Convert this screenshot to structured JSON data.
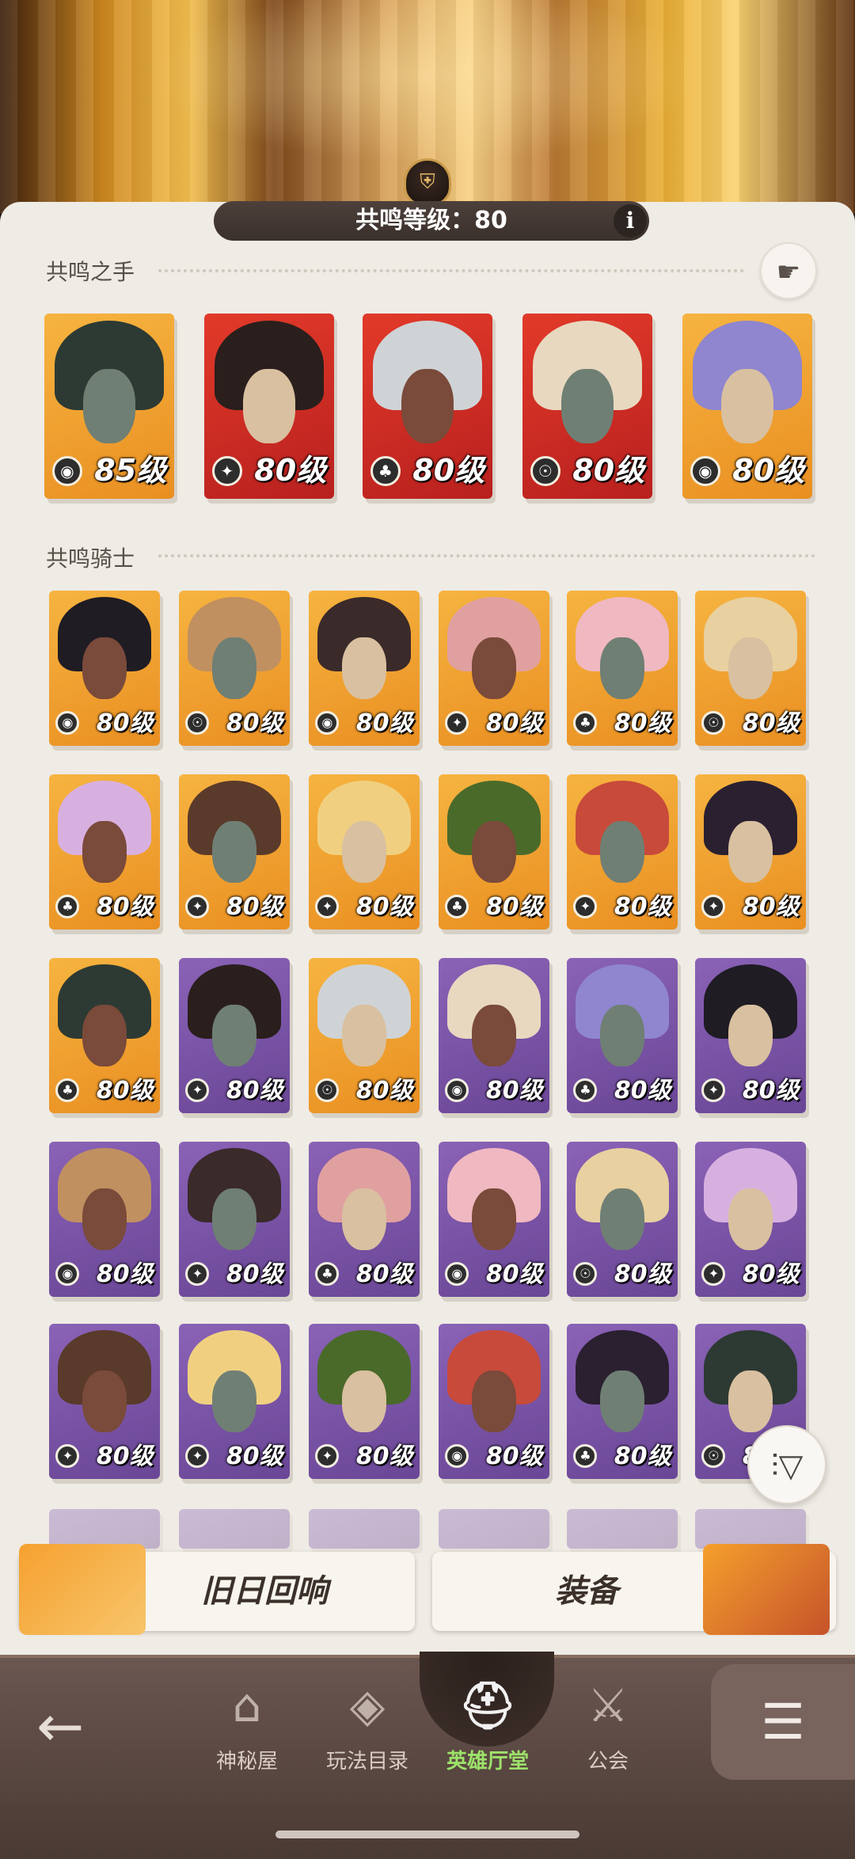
{
  "header": {
    "resonance_label": "共鸣等级：80",
    "info_label": "i",
    "crest_icon": "helmet-crest-icon"
  },
  "hand_section": {
    "title": "共鸣之手",
    "heroes": [
      {
        "level": "85级",
        "bg": "gold",
        "faction": "dark"
      },
      {
        "level": "80级",
        "bg": "red",
        "faction": "blue"
      },
      {
        "level": "80级",
        "bg": "red",
        "faction": "green"
      },
      {
        "level": "80级",
        "bg": "red",
        "faction": "gold"
      },
      {
        "level": "80级",
        "bg": "gold",
        "faction": "dark"
      }
    ]
  },
  "knight_section": {
    "title": "共鸣骑士",
    "rows": [
      [
        {
          "level": "80级",
          "bg": "gold",
          "faction": "dark"
        },
        {
          "level": "80级",
          "bg": "gold",
          "faction": "gold"
        },
        {
          "level": "80级",
          "bg": "gold",
          "faction": "dark"
        },
        {
          "level": "80级",
          "bg": "gold",
          "faction": "blue"
        },
        {
          "level": "80级",
          "bg": "gold",
          "faction": "green"
        },
        {
          "level": "80级",
          "bg": "gold",
          "faction": "gold"
        }
      ],
      [
        {
          "level": "80级",
          "bg": "gold",
          "faction": "green"
        },
        {
          "level": "80级",
          "bg": "gold",
          "faction": "blue"
        },
        {
          "level": "80级",
          "bg": "gold",
          "faction": "blue"
        },
        {
          "level": "80级",
          "bg": "gold",
          "faction": "green"
        },
        {
          "level": "80级",
          "bg": "gold",
          "faction": "blue"
        },
        {
          "level": "80级",
          "bg": "gold",
          "faction": "blue"
        }
      ],
      [
        {
          "level": "80级",
          "bg": "gold",
          "faction": "green"
        },
        {
          "level": "80级",
          "bg": "purple",
          "faction": "blue"
        },
        {
          "level": "80级",
          "bg": "gold",
          "faction": "gold"
        },
        {
          "level": "80级",
          "bg": "purple",
          "faction": "dark"
        },
        {
          "level": "80级",
          "bg": "purple",
          "faction": "green"
        },
        {
          "level": "80级",
          "bg": "purple",
          "faction": "blue"
        }
      ],
      [
        {
          "level": "80级",
          "bg": "purple",
          "faction": "dark"
        },
        {
          "level": "80级",
          "bg": "purple",
          "faction": "blue"
        },
        {
          "level": "80级",
          "bg": "purple",
          "faction": "green"
        },
        {
          "level": "80级",
          "bg": "purple",
          "faction": "dark"
        },
        {
          "level": "80级",
          "bg": "purple",
          "faction": "gold"
        },
        {
          "level": "80级",
          "bg": "purple",
          "faction": "blue"
        }
      ],
      [
        {
          "level": "80级",
          "bg": "purple",
          "faction": "blue"
        },
        {
          "level": "80级",
          "bg": "purple",
          "faction": "blue"
        },
        {
          "level": "80级",
          "bg": "purple",
          "faction": "blue"
        },
        {
          "level": "80级",
          "bg": "purple",
          "faction": "dark"
        },
        {
          "level": "80级",
          "bg": "purple",
          "faction": "green"
        },
        {
          "level": "80级",
          "bg": "purple",
          "faction": "gold"
        }
      ]
    ]
  },
  "actions": {
    "echo_label": "旧日回响",
    "equipment_label": "装备"
  },
  "nav": {
    "items": [
      {
        "label": "神秘屋",
        "icon": "mystery-house-icon"
      },
      {
        "label": "玩法目录",
        "icon": "game-modes-icon"
      },
      {
        "label": "英雄厅堂",
        "icon": "knight-helmet-icon",
        "active": true
      },
      {
        "label": "公会",
        "icon": "guild-swords-icon"
      }
    ],
    "back_icon": "back-arrow-icon",
    "menu_icon": "menu-list-icon"
  },
  "filter_icon": "filter-icon",
  "colors": {
    "accent_green": "#9de26a",
    "card_gold": "#f6b440",
    "card_red": "#e23a2a",
    "card_purple": "#8a62b6"
  }
}
